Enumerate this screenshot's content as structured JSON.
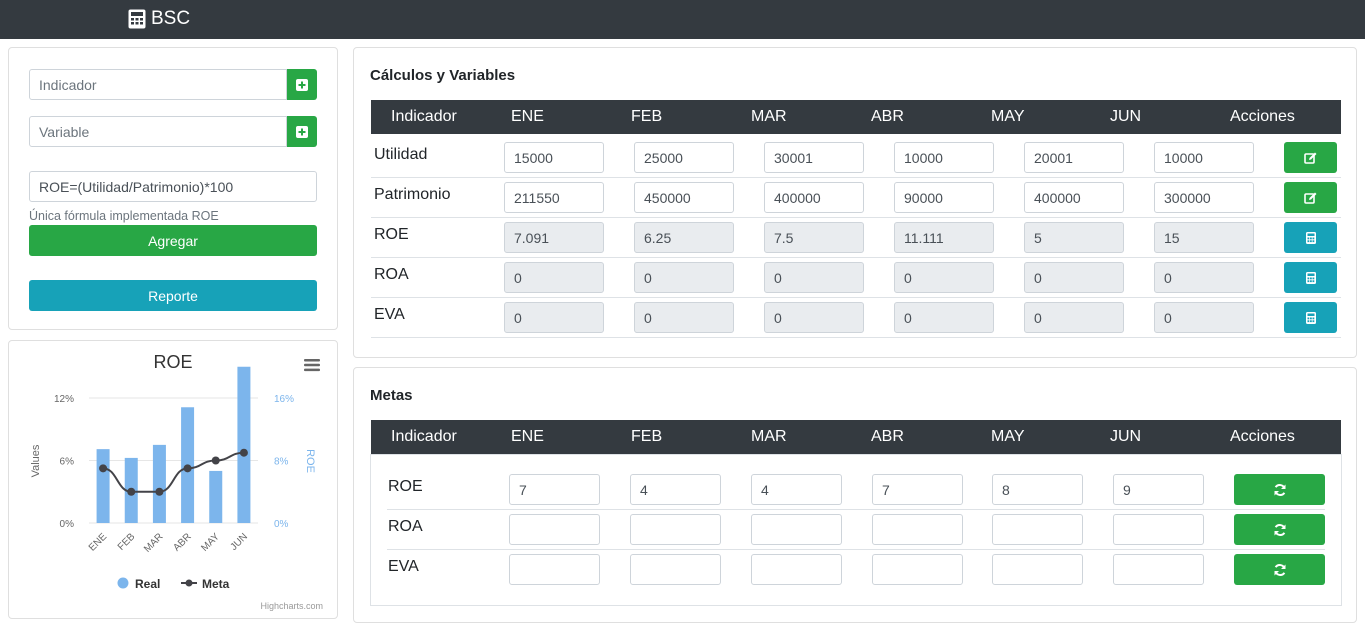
{
  "app": {
    "title": "BSC",
    "icon": "calculator-icon"
  },
  "form": {
    "indicador_placeholder": "Indicador",
    "variable_placeholder": "Variable",
    "formula_value": "ROE=(Utilidad/Patrimonio)*100",
    "help_text": "Única fórmula implementada ROE",
    "add_label": "Agregar",
    "report_label": "Reporte"
  },
  "chart_data": {
    "type": "bar",
    "title": "ROE",
    "categories": [
      "ENE",
      "FEB",
      "MAR",
      "ABR",
      "MAY",
      "JUN"
    ],
    "series": [
      {
        "name": "Real",
        "type": "bar",
        "axis": "left",
        "values": [
          7.091,
          6.25,
          7.5,
          11.111,
          5,
          15
        ],
        "color": "#7cb5ec"
      },
      {
        "name": "Meta",
        "type": "line",
        "axis": "right",
        "values": [
          7,
          4,
          4,
          7,
          8,
          9
        ],
        "color": "#434348"
      }
    ],
    "ylabel": "Values",
    "y2label": "ROE",
    "yticks": [
      "0%",
      "6%",
      "12%"
    ],
    "y2ticks": [
      "0%",
      "8%",
      "16%"
    ],
    "ylim": [
      0,
      12
    ],
    "y2lim": [
      0,
      16
    ],
    "legend": "bottom-center",
    "credits": "Highcharts.com"
  },
  "calc": {
    "title": "Cálculos y Variables",
    "headers": [
      "Indicador",
      "ENE",
      "FEB",
      "MAR",
      "ABR",
      "MAY",
      "JUN",
      "Acciones"
    ],
    "rows": [
      {
        "label": "Utilidad",
        "values": [
          "15000",
          "25000",
          "30001",
          "10000",
          "20001",
          "10000"
        ],
        "readonly": false,
        "action": "edit-icon"
      },
      {
        "label": "Patrimonio",
        "values": [
          "211550",
          "450000",
          "400000",
          "90000",
          "400000",
          "300000"
        ],
        "readonly": false,
        "action": "edit-icon"
      },
      {
        "label": "ROE",
        "values": [
          "7.091",
          "6.25",
          "7.5",
          "11.111",
          "5",
          "15"
        ],
        "readonly": true,
        "action": "calculator-icon"
      },
      {
        "label": "ROA",
        "values": [
          "0",
          "0",
          "0",
          "0",
          "0",
          "0"
        ],
        "readonly": true,
        "action": "calculator-icon"
      },
      {
        "label": "EVA",
        "values": [
          "0",
          "0",
          "0",
          "0",
          "0",
          "0"
        ],
        "readonly": true,
        "action": "calculator-icon"
      }
    ]
  },
  "metas": {
    "title": "Metas",
    "headers": [
      "Indicador",
      "ENE",
      "FEB",
      "MAR",
      "ABR",
      "MAY",
      "JUN",
      "Acciones"
    ],
    "rows": [
      {
        "label": "ROE",
        "values": [
          "7",
          "4",
          "4",
          "7",
          "8",
          "9"
        ],
        "action": "refresh-icon"
      },
      {
        "label": "ROA",
        "values": [
          "",
          "",
          "",
          "",
          "",
          ""
        ],
        "action": "refresh-icon"
      },
      {
        "label": "EVA",
        "values": [
          "",
          "",
          "",
          "",
          "",
          ""
        ],
        "action": "refresh-icon"
      }
    ]
  },
  "colors": {
    "navbar": "#343a40",
    "success": "#28a745",
    "info": "#17a2b8",
    "readonly": "#e9ecef"
  }
}
